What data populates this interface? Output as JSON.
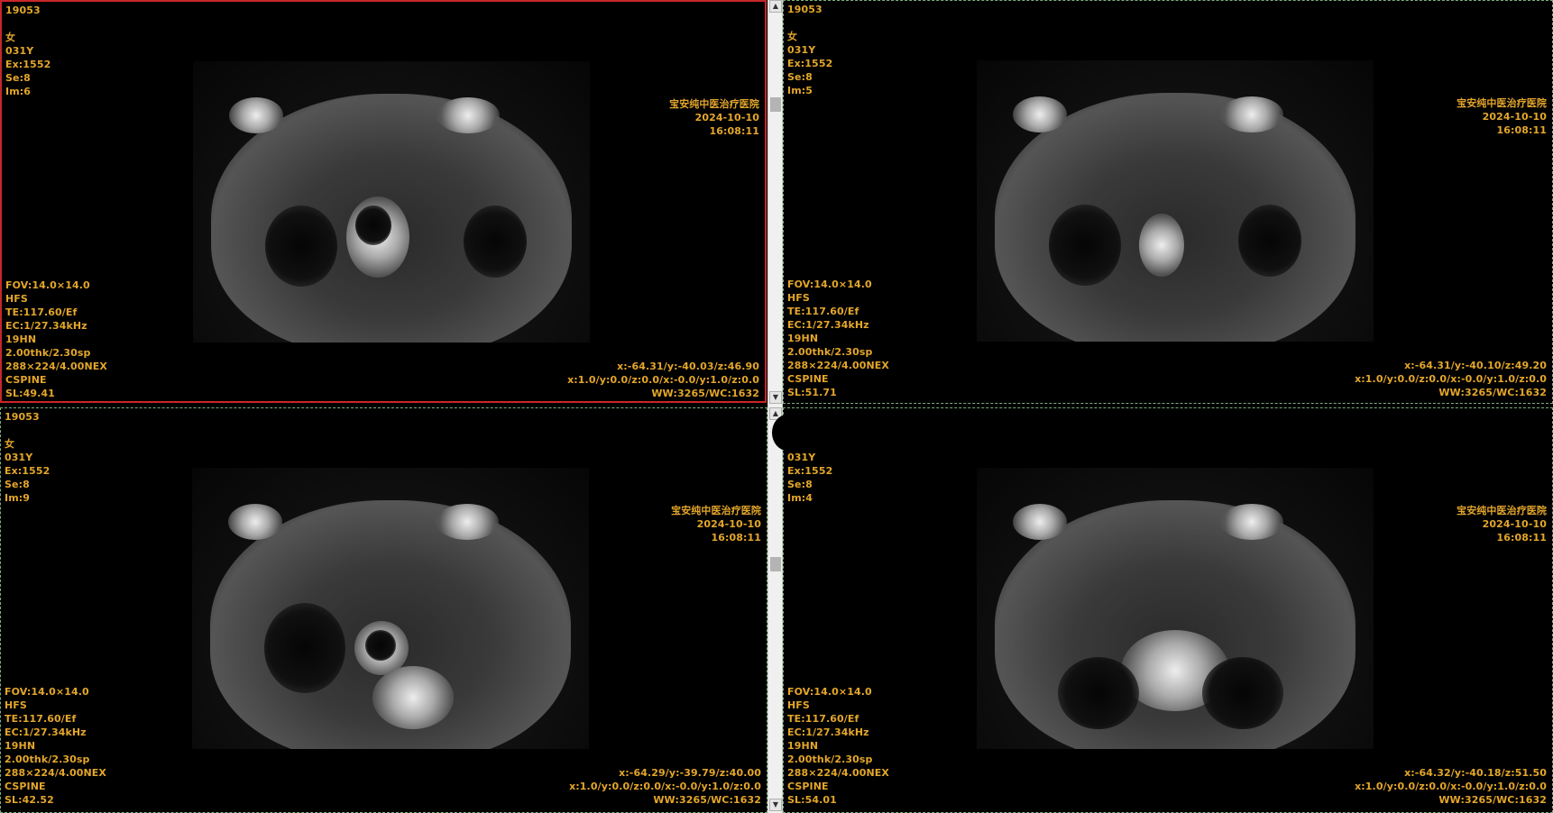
{
  "viewports": [
    {
      "id": "tl",
      "top_left": [
        "19053",
        "",
        "女",
        "031Y",
        "Ex:1552",
        "Se:8",
        "Im:6"
      ],
      "top_right": [
        "宝安纯中医治疗医院",
        "2024-10-10",
        "16:08:11"
      ],
      "bottom_left": [
        "FOV:14.0×14.0",
        "HFS",
        "TE:117.60/Ef",
        "EC:1/27.34kHz",
        "19HN",
        "2.00thk/2.30sp",
        "288×224/4.00NEX",
        "CSPINE",
        "SL:49.41"
      ],
      "bottom_right": [
        "x:-64.31/y:-40.03/z:46.90",
        "x:1.0/y:0.0/z:0.0/x:-0.0/y:1.0/z:0.0",
        "WW:3265/WC:1632"
      ]
    },
    {
      "id": "tr",
      "top_left": [
        "19053",
        "",
        "女",
        "031Y",
        "Ex:1552",
        "Se:8",
        "Im:5"
      ],
      "top_right": [
        "宝安纯中医治疗医院",
        "2024-10-10",
        "16:08:11"
      ],
      "bottom_left": [
        "FOV:14.0×14.0",
        "HFS",
        "TE:117.60/Ef",
        "EC:1/27.34kHz",
        "19HN",
        "2.00thk/2.30sp",
        "288×224/4.00NEX",
        "CSPINE",
        "SL:51.71"
      ],
      "bottom_right": [
        "x:-64.31/y:-40.10/z:49.20",
        "x:1.0/y:0.0/z:0.0/x:-0.0/y:1.0/z:0.0",
        "WW:3265/WC:1632"
      ]
    },
    {
      "id": "bl",
      "top_left": [
        "19053",
        "",
        "女",
        "031Y",
        "Ex:1552",
        "Se:8",
        "Im:9"
      ],
      "top_right": [
        "宝安纯中医治疗医院",
        "2024-10-10",
        "16:08:11"
      ],
      "bottom_left": [
        "FOV:14.0×14.0",
        "HFS",
        "TE:117.60/Ef",
        "EC:1/27.34kHz",
        "19HN",
        "2.00thk/2.30sp",
        "288×224/4.00NEX",
        "CSPINE",
        "SL:42.52"
      ],
      "bottom_right": [
        "x:-64.29/y:-39.79/z:40.00",
        "x:1.0/y:0.0/z:0.0/x:-0.0/y:1.0/z:0.0",
        "WW:3265/WC:1632"
      ]
    },
    {
      "id": "br",
      "top_left": [
        "",
        "",
        "",
        "031Y",
        "Ex:1552",
        "Se:8",
        "Im:4"
      ],
      "top_right": [
        "宝安纯中医治疗医院",
        "2024-10-10",
        "16:08:11"
      ],
      "bottom_left": [
        "FOV:14.0×14.0",
        "HFS",
        "TE:117.60/Ef",
        "EC:1/27.34kHz",
        "19HN",
        "2.00thk/2.30sp",
        "288×224/4.00NEX",
        "CSPINE",
        "SL:54.01"
      ],
      "bottom_right": [
        "x:-64.32/y:-40.18/z:51.50",
        "x:1.0/y:0.0/z:0.0/x:-0.0/y:1.0/z:0.0",
        "WW:3265/WC:1632"
      ]
    }
  ],
  "scrollbar": {
    "up_icon": "arrow-up-icon",
    "down_icon": "arrow-down-icon"
  },
  "colors": {
    "overlay_text": "#e3a62a",
    "selected_border": "#c8262a",
    "unselected_border": "#7fae7f"
  }
}
